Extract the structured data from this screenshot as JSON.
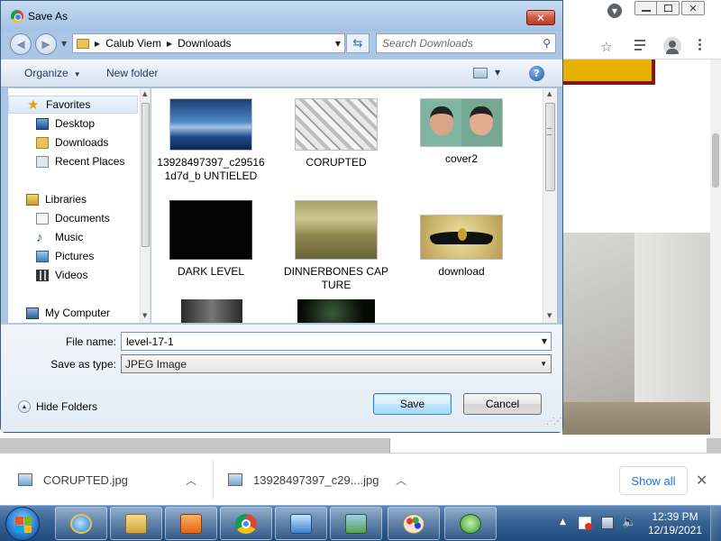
{
  "dialog": {
    "title": "Save As",
    "close_glyph": "✕",
    "breadcrumb": [
      "Calub Viem",
      "Downloads"
    ],
    "search_placeholder": "Search Downloads",
    "toolbar": {
      "organize": "Organize",
      "new_folder": "New folder",
      "help": "?"
    },
    "nav": {
      "favorites": "Favorites",
      "favorite_items": [
        "Desktop",
        "Downloads",
        "Recent Places"
      ],
      "libraries": "Libraries",
      "library_items": [
        "Documents",
        "Music",
        "Pictures",
        "Videos"
      ],
      "computer": "My Computer"
    },
    "files": [
      {
        "name": "13928497397_c295161d7d_b UNTIELED",
        "icon": "sky-thumbnail"
      },
      {
        "name": "CORUPTED",
        "icon": "glitch-thumbnail"
      },
      {
        "name": "cover2",
        "icon": "faces-thumbnail"
      },
      {
        "name": "DARK LEVEL",
        "icon": "dark-thumbnail"
      },
      {
        "name": "DINNERBONES CAPTURE",
        "icon": "hallway-thumbnail"
      },
      {
        "name": "download",
        "icon": "wings-thumbnail"
      }
    ],
    "form": {
      "file_name_label": "File name:",
      "file_name_value": "level-17-1",
      "save_type_label": "Save as type:",
      "save_type_value": "JPEG Image",
      "hide_folders": "Hide Folders",
      "save": "Save",
      "cancel": "Cancel"
    }
  },
  "downloads": {
    "items": [
      "CORUPTED.jpg",
      "13928497397_c29....jpg"
    ],
    "show_all": "Show all"
  },
  "taskbar": {
    "time": "12:39 PM",
    "date": "12/19/2021"
  },
  "colors": {
    "dialog_frame": "#aac6e4",
    "link_blue": "#1a73e8",
    "taskbar": "#3a6596"
  }
}
